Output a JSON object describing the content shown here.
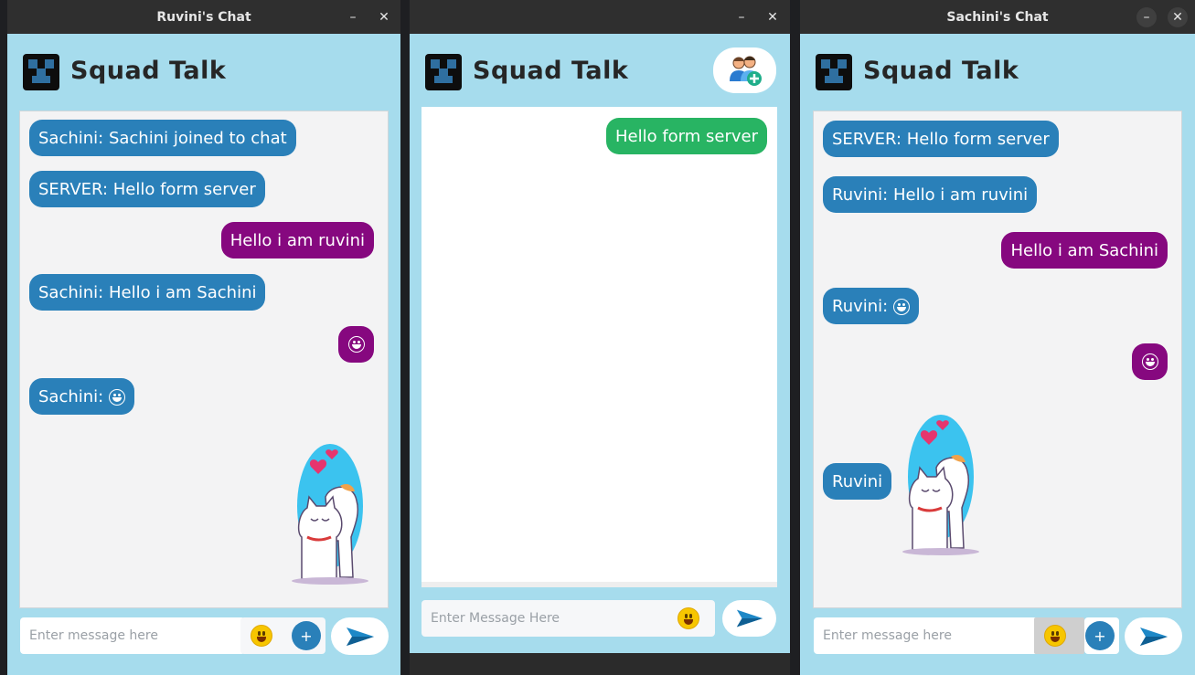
{
  "windows": {
    "left": {
      "title": "Ruvini's Chat",
      "app_title": "Squad Talk",
      "messages": [
        "Sachini: Sachini joined to chat",
        "SERVER: Hello form server",
        "Hello i am ruvini",
        "Sachini: Hello i am Sachini",
        "Sachini:"
      ],
      "input_placeholder": "Enter message here",
      "plus_label": "+"
    },
    "middle": {
      "title": "",
      "app_title": "Squad Talk",
      "messages": [
        "Hello form server"
      ],
      "input_placeholder": "Enter Message Here"
    },
    "right": {
      "title": "Sachini's Chat",
      "app_title": "Squad Talk",
      "messages": [
        "SERVER: Hello form server",
        "Ruvini: Hello i am ruvini",
        "Hello i am Sachini",
        "Ruvini:",
        "Ruvini"
      ],
      "input_placeholder": "Enter message here",
      "plus_label": "+"
    }
  },
  "window_controls": {
    "minimize": "–",
    "close": "✕"
  },
  "colors": {
    "window_bg": "#a6dced",
    "incoming_bubble": "#2a80b9",
    "outgoing_bubble": "#86087f",
    "server_bubble": "#28b463"
  },
  "icons": {
    "logo": "squad-talk-logo-icon",
    "emoji": "smile-emoji-icon",
    "send": "paper-plane-icon",
    "add_user": "add-user-icon",
    "sticker": "cat-dog-love-sticker"
  }
}
